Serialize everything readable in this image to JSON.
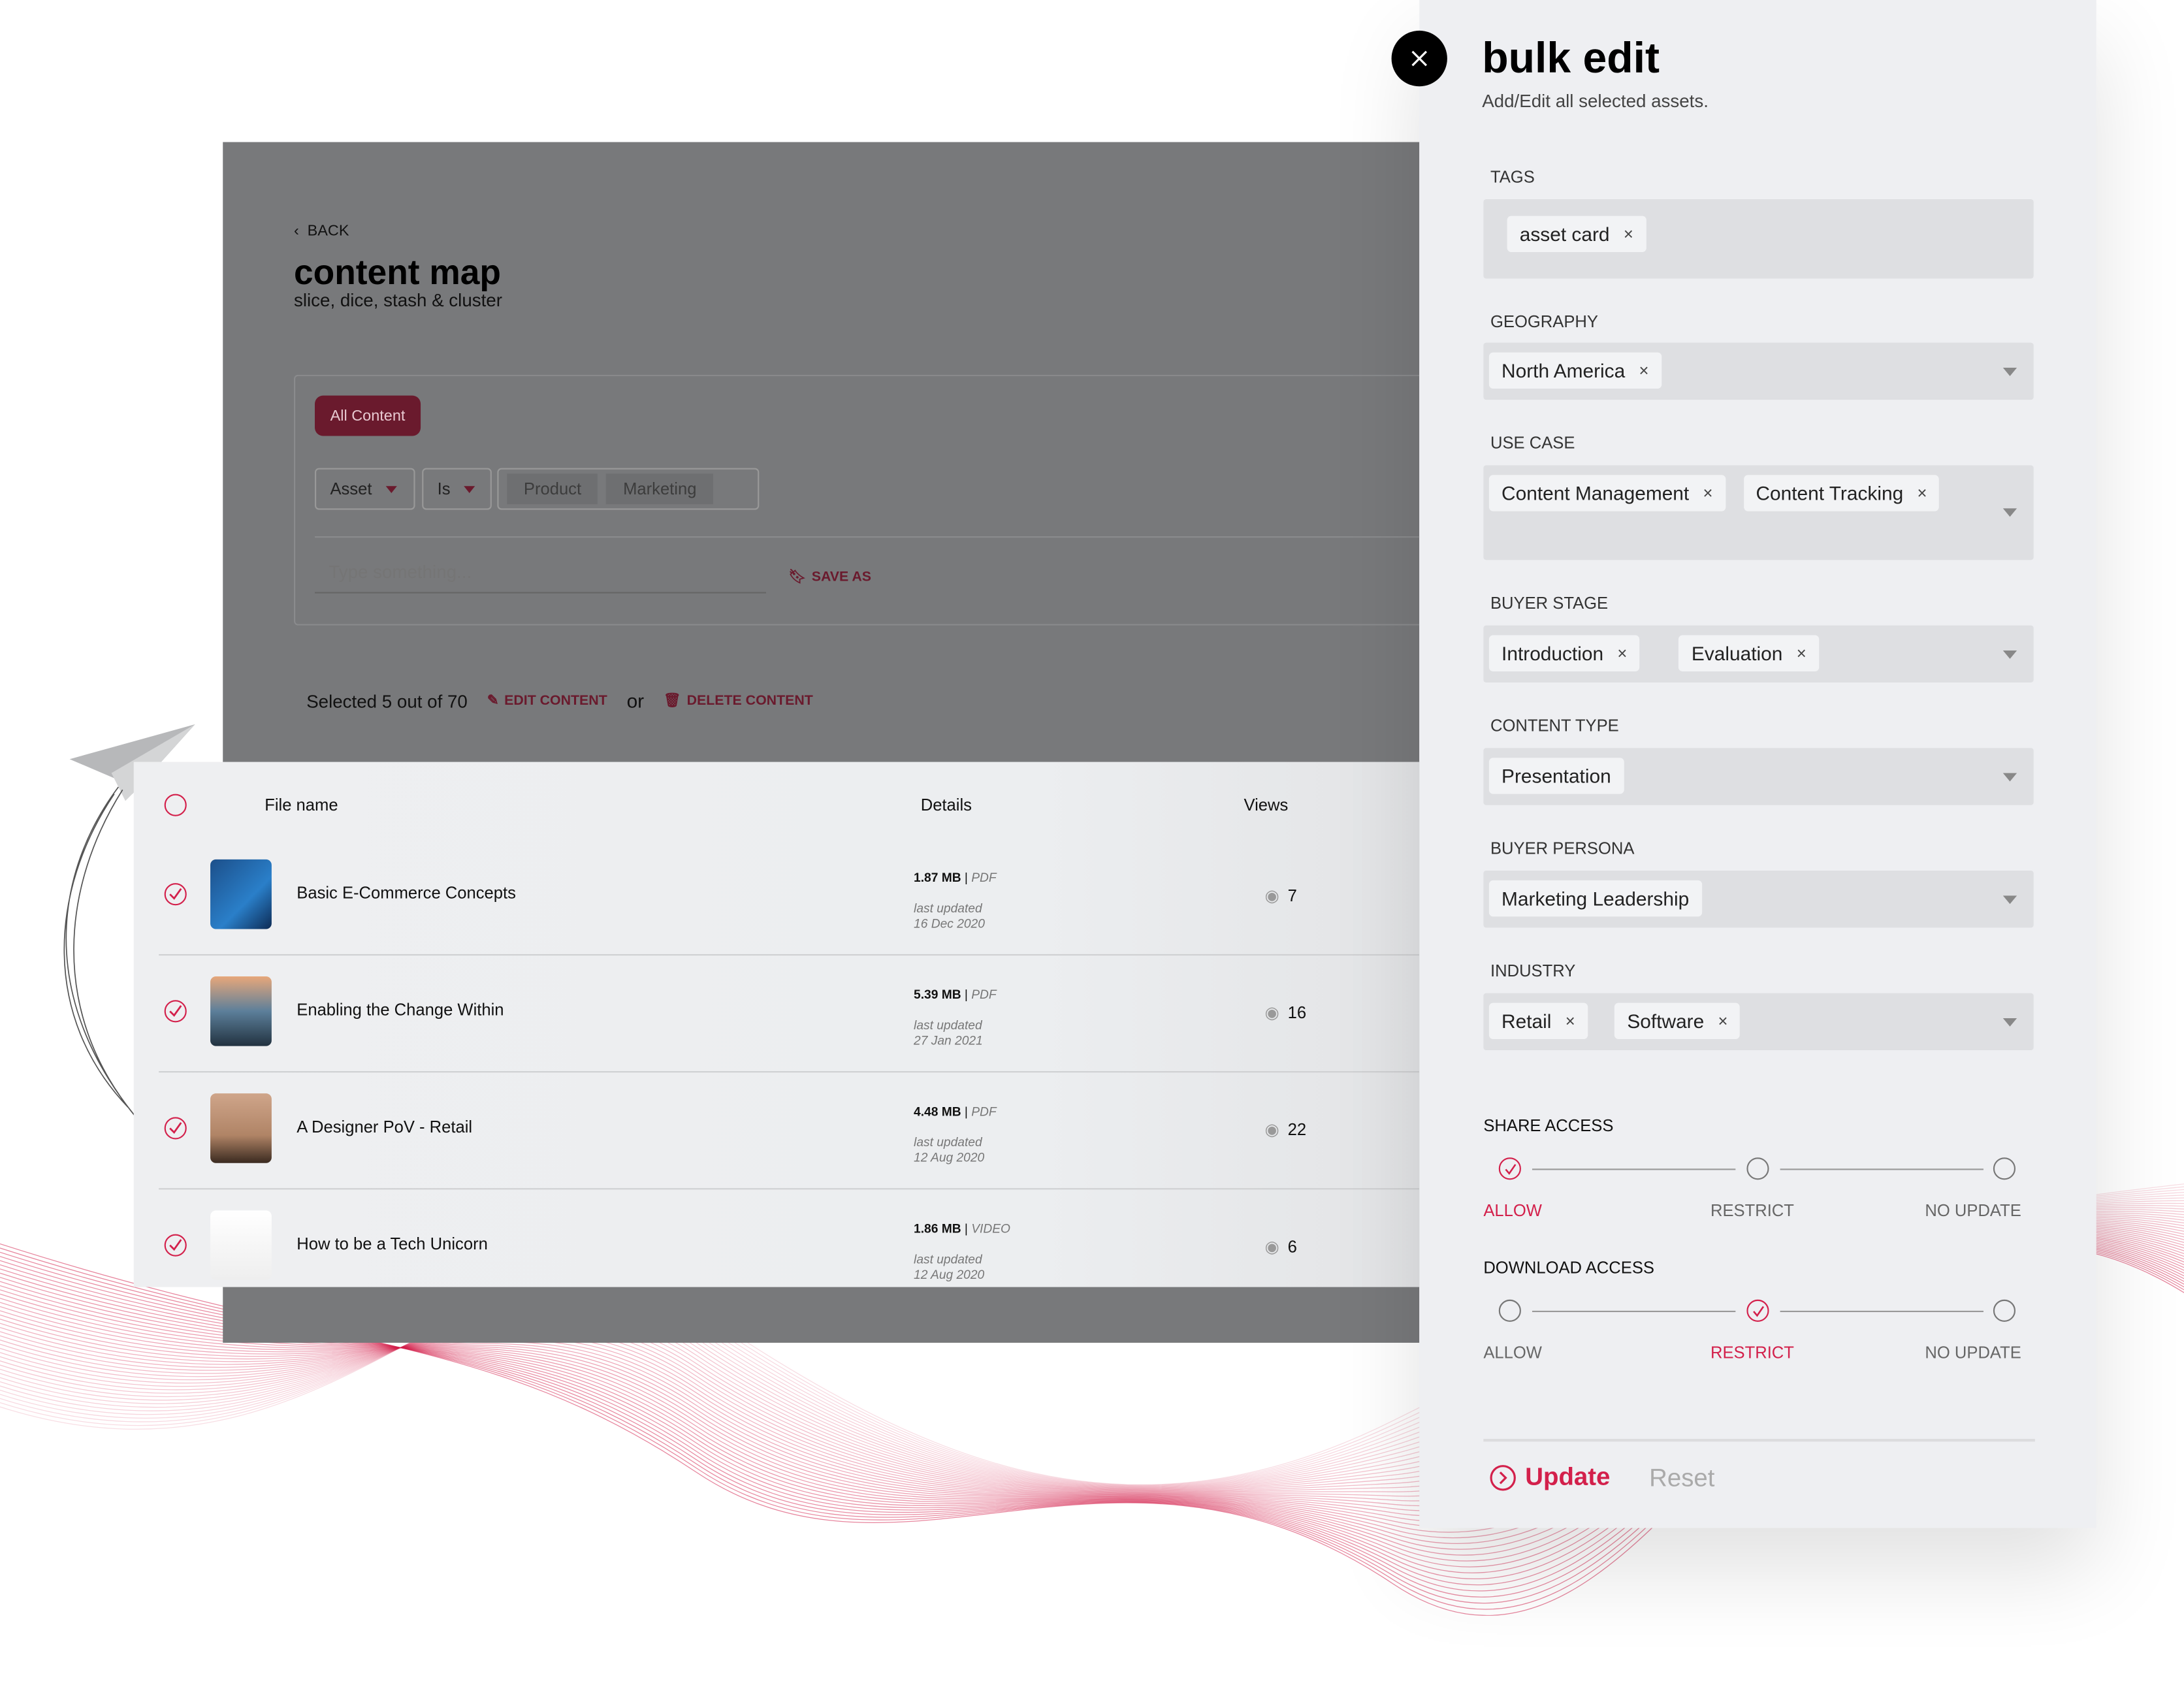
{
  "colors": {
    "accent": "#d3204b",
    "dark_accent": "#6a1a2d",
    "panel_bg": "#eeeff2"
  },
  "page": {
    "back_label": "BACK",
    "title": "content map",
    "subtitle": "slice, dice, stash & cluster",
    "filter_tab": "All Content",
    "filter": {
      "field": "Asset",
      "operator": "Is",
      "values": [
        "Product",
        "Marketing"
      ]
    },
    "search_placeholder": "Type something...",
    "save_as": "SAVE AS",
    "selection_text": "Selected 5 out of 70",
    "edit_content": "EDIT CONTENT",
    "or_text": "or",
    "delete_content": "DELETE CONTENT"
  },
  "table": {
    "headers": {
      "file_name": "File name",
      "details": "Details",
      "views": "Views"
    },
    "rows": [
      {
        "name": "Basic E-Commerce Concepts",
        "size": "1.87 MB",
        "type": "PDF",
        "updated_label": "last updated",
        "date": "16 Dec 2020",
        "views": "7",
        "checked": true
      },
      {
        "name": "Enabling the Change Within",
        "size": "5.39 MB",
        "type": "PDF",
        "updated_label": "last updated",
        "date": "27 Jan 2021",
        "views": "16",
        "checked": true
      },
      {
        "name": "A Designer PoV - Retail",
        "size": "4.48 MB",
        "type": "PDF",
        "updated_label": "last updated",
        "date": "12 Aug 2020",
        "views": "22",
        "checked": true
      },
      {
        "name": "How to be a Tech Unicorn",
        "size": "1.86 MB",
        "type": "VIDEO",
        "updated_label": "last updated",
        "date": "12 Aug 2020",
        "views": "6",
        "checked": true
      }
    ]
  },
  "panel": {
    "title": "bulk edit",
    "subtitle": "Add/Edit all selected assets.",
    "tags": {
      "label": "TAGS",
      "values": [
        "asset card"
      ]
    },
    "geography": {
      "label": "GEOGRAPHY",
      "values": [
        "North America"
      ]
    },
    "use_case": {
      "label": "USE CASE",
      "values": [
        "Content Management",
        "Content Tracking"
      ]
    },
    "buyer_stage": {
      "label": "BUYER STAGE",
      "values": [
        "Introduction",
        "Evaluation"
      ]
    },
    "content_type": {
      "label": "CONTENT TYPE",
      "values": [
        "Presentation"
      ]
    },
    "buyer_persona": {
      "label": "BUYER PERSONA",
      "values": [
        "Marketing Leadership"
      ]
    },
    "industry": {
      "label": "INDUSTRY",
      "values": [
        "Retail",
        "Software"
      ]
    },
    "share_access": {
      "label": "SHARE ACCESS",
      "options": [
        "ALLOW",
        "RESTRICT",
        "NO UPDATE"
      ],
      "selected": "ALLOW"
    },
    "download_access": {
      "label": "DOWNLOAD ACCESS",
      "options": [
        "ALLOW",
        "RESTRICT",
        "NO UPDATE"
      ],
      "selected": "RESTRICT"
    },
    "update_label": "Update",
    "reset_label": "Reset"
  }
}
